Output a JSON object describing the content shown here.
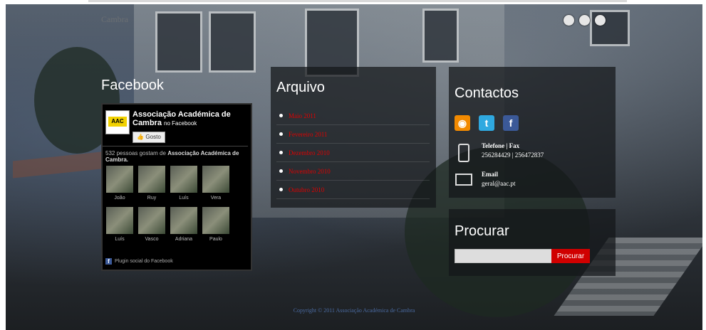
{
  "site": {
    "logo_text": "Cambra",
    "copyright": "Copyright © 2011 Associação Académica de Cambra"
  },
  "slider": {
    "dot_count": 3
  },
  "facebook": {
    "heading": "Facebook",
    "page_name": "Associação Académica de Cambra",
    "page_sub": "no Facebook",
    "like_button": "Gosto",
    "count_prefix": "532 pessoas gostam de",
    "count_target": "Associação Académica de Cambra.",
    "fans": [
      "João",
      "Ruy",
      "Luís",
      "Vera",
      "Luís",
      "Vasco",
      "Adriana",
      "Paulo"
    ],
    "plugin_label": "Plugin social do Facebook"
  },
  "arquivo": {
    "heading": "Arquivo",
    "items": [
      "Maio 2011",
      "Fevereiro 2011",
      "Dezembro 2010",
      "Novembro 2010",
      "Outubro 2010"
    ]
  },
  "contactos": {
    "heading": "Contactos",
    "social": [
      "rss-icon",
      "twitter-icon",
      "facebook-icon"
    ],
    "phone_label": "Telefone | Fax",
    "phone_value": "256284429 | 256472837",
    "email_label": "Email",
    "email_value": "geral@aac.pt"
  },
  "procurar": {
    "heading": "Procurar",
    "input_value": "",
    "button_label": "Procurar"
  },
  "colors": {
    "link_red": "#e00000",
    "button_red": "#d00000"
  }
}
